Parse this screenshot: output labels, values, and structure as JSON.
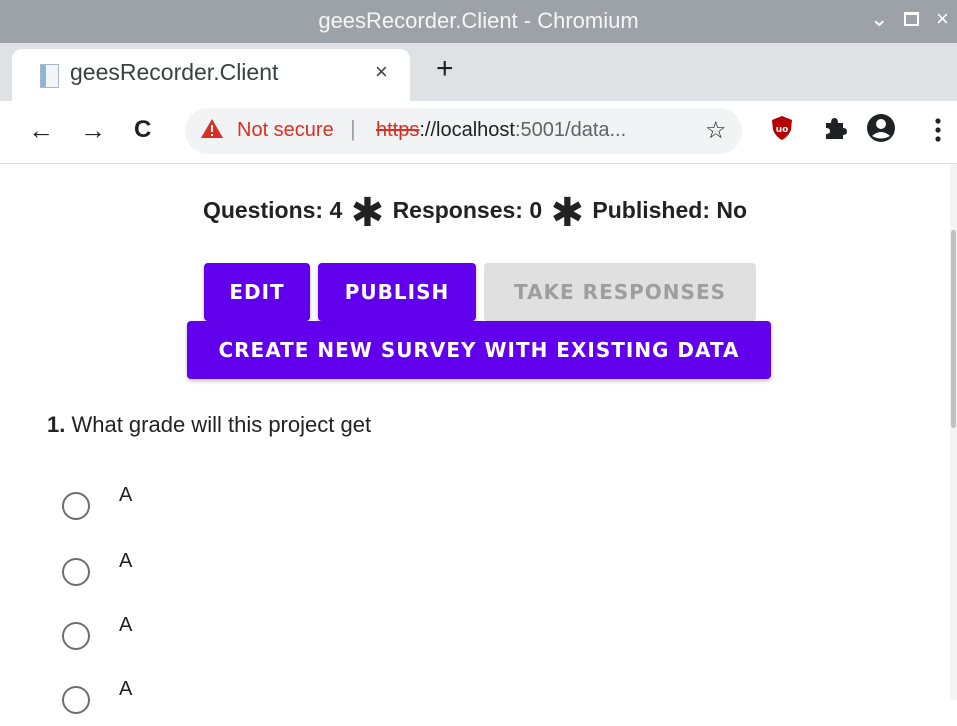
{
  "window": {
    "title": "geesRecorder.Client - Chromium",
    "controls": {
      "minimize": "⌄",
      "maximize": "▫",
      "close": "×"
    }
  },
  "tab": {
    "title": "geesRecorder.Client",
    "close": "×",
    "new_tab": "+"
  },
  "toolbar": {
    "back": "←",
    "forward": "→",
    "reload": "C",
    "security_label": "Not secure",
    "separator": "|",
    "url_scheme": "https",
    "url_host": "://localhost",
    "url_rest": ":5001/data...",
    "bookmark": "☆"
  },
  "stats": {
    "questions": "Questions: 4",
    "responses": "Responses: 0",
    "published": "Published: No",
    "separator": "✱"
  },
  "buttons": {
    "edit": "EDIT",
    "publish": "PUBLISH",
    "take_responses": "TAKE RESPONSES",
    "create_new": "CREATE NEW SURVEY WITH EXISTING DATA"
  },
  "question": {
    "number": "1.",
    "text": " What grade will this project get",
    "options": [
      "A",
      "A",
      "A",
      "A"
    ]
  },
  "colors": {
    "primary": "#6200ee",
    "disabled": "#e0e0e0",
    "warning": "#d93025",
    "ublock": "#b40000"
  },
  "icons": {
    "security": "warning-triangle-icon",
    "bookmark": "star-icon",
    "ublock": "ublock-icon",
    "extensions": "puzzle-icon",
    "profile": "account-icon",
    "menu": "kebab-menu-icon"
  }
}
